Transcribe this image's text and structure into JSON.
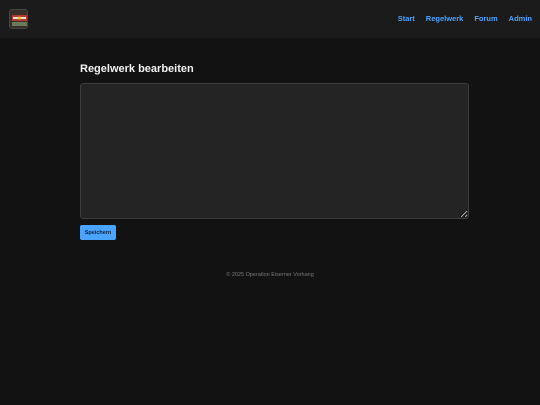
{
  "nav": {
    "items": [
      {
        "label": "Start"
      },
      {
        "label": "Regelwerk"
      },
      {
        "label": "Forum"
      },
      {
        "label": "Admin"
      }
    ]
  },
  "main": {
    "title": "Regelwerk bearbeiten",
    "editor_value": "",
    "save_label": "Speichern"
  },
  "footer": {
    "text": "© 2025 Operation Eiserner Vorhang"
  },
  "colors": {
    "accent": "#4aa3ff",
    "background": "#121212",
    "header": "#1b1b1b"
  }
}
